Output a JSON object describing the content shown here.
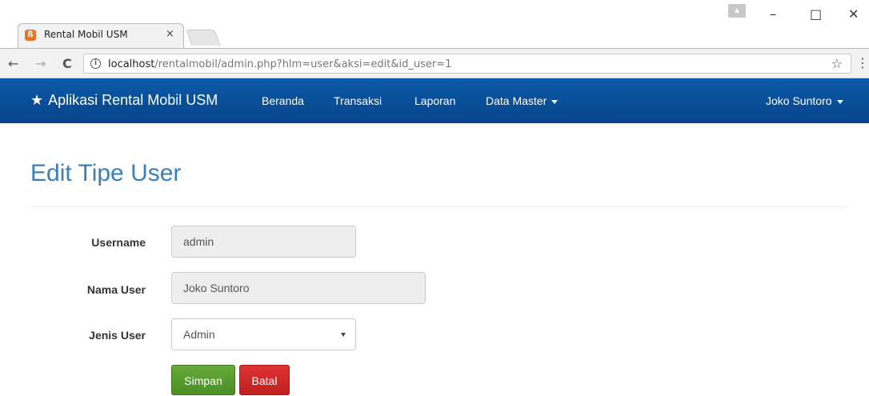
{
  "browser": {
    "tab_title": "Rental Mobil USM",
    "tab_close": "×",
    "favicon": "xampp-icon",
    "url_host": "localhost",
    "url_path": "/rentalmobil/admin.php?hlm=user&aksi=edit&id_user=1",
    "back_icon": "←",
    "forward_icon": "→",
    "reload_icon": "C",
    "info_icon": "i",
    "star_icon": "☆",
    "menu_icon": "⋮",
    "minimize_icon": "–",
    "maximize_icon": "□",
    "close_icon": "✕",
    "profile_icon": "▲"
  },
  "navbar": {
    "brand_star": "★",
    "brand": "Aplikasi Rental Mobil USM",
    "links": [
      "Beranda",
      "Transaksi",
      "Laporan",
      "Data Master"
    ],
    "user": "Joko Suntoro",
    "color": "#08448a"
  },
  "page": {
    "title": "Edit Tipe User"
  },
  "form": {
    "username_label": "Username",
    "username_value": "admin",
    "nama_label": "Nama User",
    "nama_value": "Joko Suntoro",
    "jenis_label": "Jenis User",
    "jenis_value": "Admin",
    "save_label": "Simpan",
    "cancel_label": "Batal"
  }
}
